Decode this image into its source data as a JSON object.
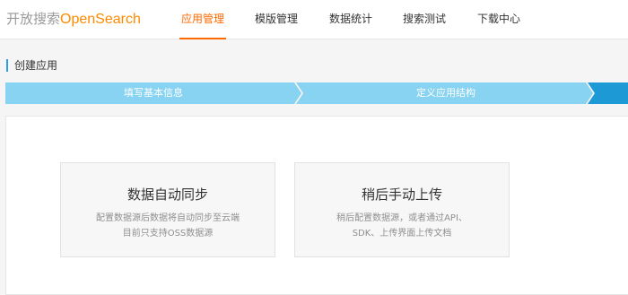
{
  "brand": {
    "name_cn": "开放搜索",
    "name_en": "OpenSearch"
  },
  "nav": {
    "items": [
      {
        "label": "应用管理",
        "active": true
      },
      {
        "label": "模版管理",
        "active": false
      },
      {
        "label": "数据统计",
        "active": false
      },
      {
        "label": "搜索测试",
        "active": false
      },
      {
        "label": "下载中心",
        "active": false
      }
    ]
  },
  "page": {
    "title": "创建应用"
  },
  "stepper": {
    "steps": [
      {
        "label": "填写基本信息"
      },
      {
        "label": "定义应用结构"
      }
    ],
    "colors": {
      "step": "#87d3f1",
      "active": "#1d9ad6"
    }
  },
  "options": [
    {
      "title": "数据自动同步",
      "desc_line1": "配置数据源后数据将自动同步至云端",
      "desc_line2": "目前只支持OSS数据源"
    },
    {
      "title": "稍后手动上传",
      "desc_line1": "稍后配置数据源，或者通过API、",
      "desc_line2": "SDK、上传界面上传文档"
    }
  ],
  "colors": {
    "accent": "#ff6a00",
    "brand_en": "#ff8a00",
    "title_bar": "#2f9de0"
  }
}
